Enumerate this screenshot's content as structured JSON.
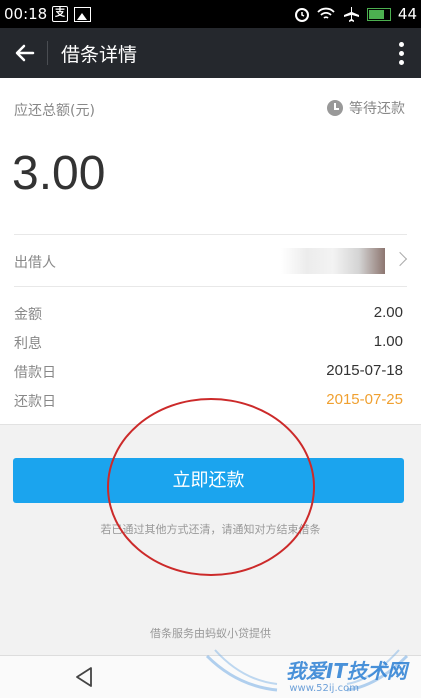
{
  "status_bar": {
    "time": "00:18",
    "pay_icon_char": "支",
    "battery": "44"
  },
  "toolbar": {
    "title": "借条详情"
  },
  "summary": {
    "label": "应还总额(元)",
    "status": "等待还款",
    "amount": "3.00"
  },
  "lender": {
    "label": "出借人"
  },
  "details": [
    {
      "key": "金额",
      "value": "2.00"
    },
    {
      "key": "利息",
      "value": "1.00"
    },
    {
      "key": "借款日",
      "value": "2015-07-18"
    },
    {
      "key": "还款日",
      "value": "2015-07-25"
    }
  ],
  "actions": {
    "pay_button": "立即还款"
  },
  "hint": "若已通过其他方式还清，请通知对方结束借条",
  "footer_note": "借条服务由蚂蚁小贷提供",
  "watermark": {
    "text": "我爱IT技术网",
    "url": "www.52ij.com"
  },
  "colors": {
    "toolbar": "#25282d",
    "primary": "#1ba4ee",
    "due_date": "#f0a030",
    "annotation": "#cc2a2a"
  }
}
